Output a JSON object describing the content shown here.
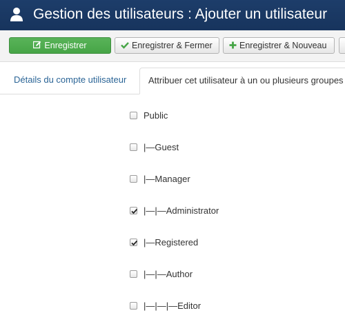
{
  "header": {
    "title": "Gestion des utilisateurs : Ajouter un utilisateur",
    "icon": "user-icon"
  },
  "toolbar": {
    "save_label": "Enregistrer",
    "save_close_label": "Enregistrer & Fermer",
    "save_new_label": "Enregistrer & Nouveau",
    "save_color": "#46a546"
  },
  "tabs": {
    "details_label": "Détails du compte utilisateur",
    "groups_label": "Attribuer cet utilisateur à un ou plusieurs groupes"
  },
  "groups": [
    {
      "label": "Public",
      "checked": false
    },
    {
      "label": "|—Guest",
      "checked": false
    },
    {
      "label": "|—Manager",
      "checked": false
    },
    {
      "label": "|—|—Administrator",
      "checked": true
    },
    {
      "label": "|—Registered",
      "checked": true
    },
    {
      "label": "|—|—Author",
      "checked": false
    },
    {
      "label": "|—|—|—Editor",
      "checked": false
    }
  ]
}
